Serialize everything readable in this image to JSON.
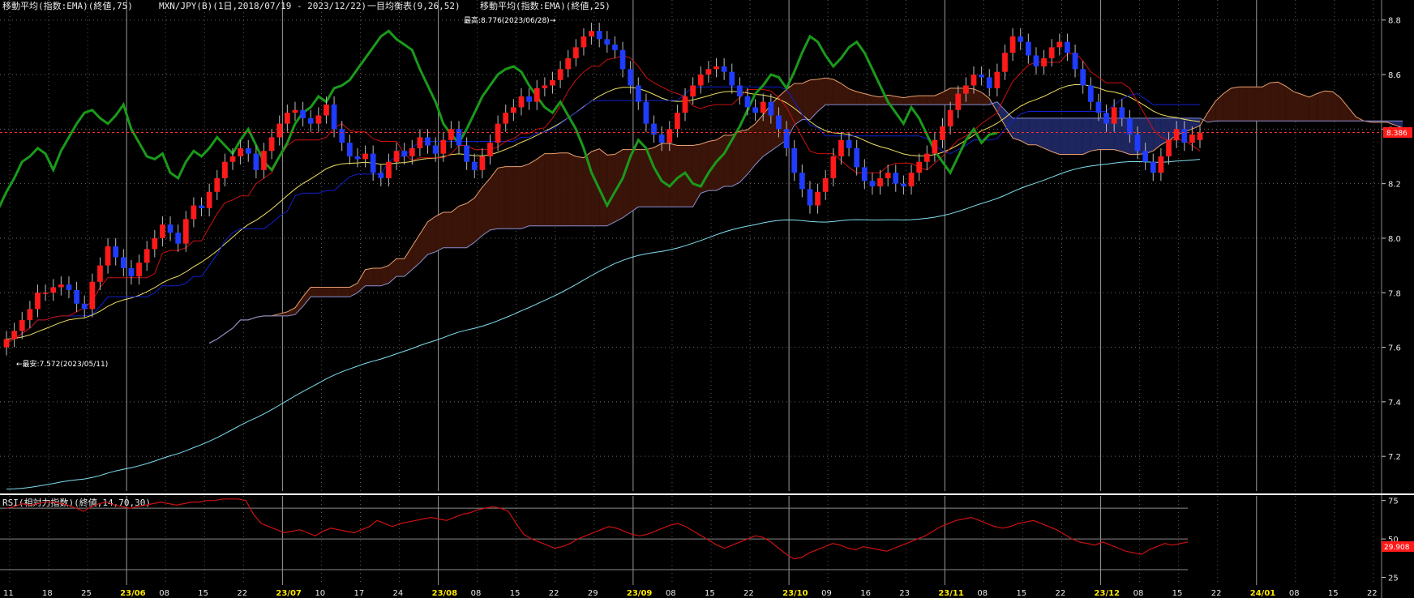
{
  "header": {
    "ma75": "移動平均(指数:EMA)(終値,75)",
    "symbol": "MXN/JPY(B)(1日,2018/07/19 - 2023/12/22)",
    "ichimoku": "一目均衡表(9,26,52)",
    "ma25": "移動平均(指数:EMA)(終値,25)"
  },
  "rsi_header": "RSI(相対力指数)(終値,14,70,30)",
  "annotations": {
    "high": "最高:8.776(2023/06/28)→",
    "low": "←最安:7.572(2023/05/11)"
  },
  "colors": {
    "up": "#ff1a1a",
    "down": "#1f3cff",
    "cloud_bull": "#3a1408",
    "cloud_bear": "#1e2660",
    "span_a": "#e8a070",
    "span_b": "#8a8fd0",
    "tenkan": "#cc1111",
    "kijun": "#1020d0",
    "ema25": "#f0e060",
    "ema75": "#80e0f0",
    "chikou": "#1a9a1a",
    "rsi": "#cc1111",
    "price_line": "#ff3030"
  },
  "chart_data": [
    {
      "type": "candlestick",
      "name_of_panel": "price",
      "ylim": [
        7.15,
        8.82
      ],
      "y_ticks": [
        "8.8",
        "8.6",
        "8.4",
        "8.2",
        "8.0",
        "7.8",
        "7.6",
        "7.4",
        "7.2"
      ],
      "last_price": "8.386",
      "high": 8.776,
      "low": 7.572,
      "x_ticks": [
        "11",
        "18",
        "25",
        "23/06",
        "08",
        "15",
        "22",
        "23/07",
        "10",
        "17",
        "24",
        "23/08",
        "08",
        "15",
        "22",
        "29",
        "23/09",
        "08",
        "15",
        "22",
        "23/10",
        "09",
        "16",
        "23",
        "23/11",
        "08",
        "15",
        "22",
        "23/12",
        "08",
        "15",
        "22",
        "24/01",
        "08",
        "15",
        "22"
      ],
      "month_ticks": [
        "23/06",
        "23/07",
        "23/08",
        "23/09",
        "23/10",
        "23/11",
        "23/12",
        "24/01"
      ],
      "close": [
        7.63,
        7.66,
        7.7,
        7.74,
        7.8,
        7.8,
        7.82,
        7.83,
        7.81,
        7.76,
        7.74,
        7.84,
        7.9,
        7.97,
        7.93,
        7.89,
        7.86,
        7.91,
        7.96,
        8.0,
        8.05,
        8.02,
        7.98,
        8.07,
        8.12,
        8.11,
        8.17,
        8.22,
        8.28,
        8.3,
        8.33,
        8.31,
        8.25,
        8.32,
        8.37,
        8.42,
        8.46,
        8.47,
        8.44,
        8.42,
        8.45,
        8.49,
        8.4,
        8.35,
        8.3,
        8.29,
        8.31,
        8.24,
        8.22,
        8.28,
        8.32,
        8.3,
        8.33,
        8.37,
        8.34,
        8.31,
        8.36,
        8.4,
        8.34,
        8.28,
        8.25,
        8.3,
        8.35,
        8.42,
        8.46,
        8.48,
        8.52,
        8.5,
        8.55,
        8.56,
        8.58,
        8.62,
        8.66,
        8.7,
        8.74,
        8.76,
        8.73,
        8.71,
        8.69,
        8.62,
        8.56,
        8.5,
        8.42,
        8.38,
        8.35,
        8.4,
        8.46,
        8.52,
        8.56,
        8.6,
        8.62,
        8.63,
        8.61,
        8.56,
        8.52,
        8.48,
        8.46,
        8.5,
        8.45,
        8.4,
        8.33,
        8.24,
        8.18,
        8.12,
        8.17,
        8.22,
        8.3,
        8.36,
        8.33,
        8.26,
        8.21,
        8.19,
        8.22,
        8.24,
        8.2,
        8.19,
        8.24,
        8.28,
        8.31,
        8.36,
        8.41,
        8.47,
        8.53,
        8.56,
        8.6,
        8.59,
        8.55,
        8.61,
        8.68,
        8.74,
        8.72,
        8.67,
        8.63,
        8.66,
        8.7,
        8.72,
        8.68,
        8.62,
        8.56,
        8.5,
        8.46,
        8.42,
        8.48,
        8.44,
        8.38,
        8.32,
        8.28,
        8.24,
        8.3,
        8.36,
        8.4,
        8.35,
        8.38,
        8.386
      ],
      "open": [
        7.6,
        7.63,
        7.66,
        7.7,
        7.74,
        7.8,
        7.8,
        7.82,
        7.83,
        7.81,
        7.76,
        7.74,
        7.84,
        7.9,
        7.97,
        7.93,
        7.89,
        7.86,
        7.91,
        7.96,
        8.0,
        8.05,
        8.02,
        7.98,
        8.07,
        8.12,
        8.11,
        8.17,
        8.22,
        8.28,
        8.3,
        8.33,
        8.31,
        8.25,
        8.32,
        8.37,
        8.42,
        8.46,
        8.47,
        8.44,
        8.42,
        8.45,
        8.49,
        8.4,
        8.35,
        8.3,
        8.29,
        8.31,
        8.24,
        8.22,
        8.28,
        8.32,
        8.3,
        8.33,
        8.37,
        8.34,
        8.31,
        8.36,
        8.4,
        8.34,
        8.28,
        8.25,
        8.3,
        8.35,
        8.42,
        8.46,
        8.48,
        8.52,
        8.5,
        8.55,
        8.56,
        8.58,
        8.62,
        8.66,
        8.7,
        8.74,
        8.76,
        8.73,
        8.71,
        8.69,
        8.62,
        8.56,
        8.5,
        8.42,
        8.38,
        8.35,
        8.4,
        8.46,
        8.52,
        8.56,
        8.6,
        8.62,
        8.63,
        8.61,
        8.56,
        8.52,
        8.48,
        8.46,
        8.5,
        8.45,
        8.4,
        8.33,
        8.24,
        8.18,
        8.12,
        8.17,
        8.22,
        8.3,
        8.36,
        8.33,
        8.26,
        8.21,
        8.19,
        8.22,
        8.24,
        8.2,
        8.19,
        8.24,
        8.28,
        8.31,
        8.36,
        8.41,
        8.47,
        8.53,
        8.56,
        8.6,
        8.59,
        8.55,
        8.61,
        8.68,
        8.74,
        8.72,
        8.67,
        8.63,
        8.66,
        8.7,
        8.72,
        8.68,
        8.62,
        8.56,
        8.5,
        8.46,
        8.42,
        8.48,
        8.44,
        8.38,
        8.32,
        8.28,
        8.24,
        8.3,
        8.36,
        8.4,
        8.35,
        8.36
      ]
    },
    {
      "type": "line",
      "name_of_panel": "rsi",
      "ylim": [
        20,
        78
      ],
      "y_ticks": [
        "75",
        "50",
        "25"
      ],
      "levels": [
        70,
        50,
        30
      ],
      "last_value": "29.908",
      "values": [
        70,
        71,
        73,
        72,
        73,
        74,
        74,
        73,
        72,
        70,
        68,
        71,
        73,
        74,
        72,
        71,
        70,
        71,
        72,
        73,
        74,
        73,
        72,
        73,
        74,
        74,
        75,
        75,
        76,
        76,
        76,
        75,
        66,
        60,
        58,
        56,
        54,
        55,
        56,
        54,
        52,
        55,
        57,
        56,
        55,
        54,
        56,
        58,
        62,
        60,
        58,
        60,
        61,
        62,
        63,
        64,
        63,
        62,
        64,
        66,
        67,
        69,
        70,
        71,
        70,
        68,
        60,
        53,
        50,
        48,
        46,
        44,
        45,
        47,
        50,
        52,
        54,
        56,
        58,
        57,
        55,
        53,
        52,
        53,
        55,
        57,
        59,
        60,
        58,
        55,
        52,
        49,
        46,
        44,
        46,
        48,
        50,
        52,
        51,
        48,
        44,
        40,
        37,
        38,
        41,
        43,
        45,
        47,
        46,
        44,
        43,
        45,
        44,
        43,
        42,
        44,
        46,
        48,
        50,
        52,
        55,
        58,
        60,
        62,
        63,
        64,
        62,
        60,
        58,
        57,
        58,
        60,
        61,
        62,
        60,
        58,
        56,
        53,
        50,
        48,
        47,
        46,
        48,
        46,
        44,
        42,
        41,
        40,
        43,
        45,
        47,
        46,
        47,
        48
      ]
    }
  ]
}
